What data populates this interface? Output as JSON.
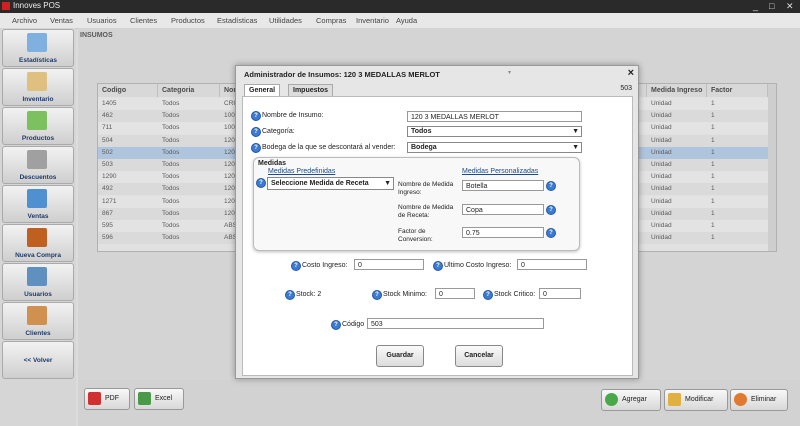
{
  "app": {
    "title": "Innoves POS",
    "minimize": "_",
    "maximize": "□",
    "close": "✕"
  },
  "menu": [
    "Archivo",
    "Ventas",
    "Usuarios",
    "Clientes",
    "Productos",
    "Estadísticas",
    "Utilidades",
    "Compras",
    "Inventario",
    "Ayuda"
  ],
  "sidebar": [
    {
      "label": "Estadísticas",
      "icon": "bar-chart-icon",
      "color": "#7fb0e0"
    },
    {
      "label": "Inventario",
      "icon": "pencil-icon",
      "color": "#e0c080"
    },
    {
      "label": "Productos",
      "icon": "basket-icon",
      "color": "#7cc060"
    },
    {
      "label": "Descuentos",
      "icon": "ticket-icon",
      "color": "#a0a0a0"
    },
    {
      "label": "Ventas",
      "icon": "cart-icon",
      "color": "#5090d0"
    },
    {
      "label": "Nueva Compra",
      "icon": "briefcase-icon",
      "color": "#c06020"
    },
    {
      "label": "Usuarios",
      "icon": "users-icon",
      "color": "#6090c0"
    },
    {
      "label": "Clientes",
      "icon": "clients-icon",
      "color": "#d09050"
    },
    {
      "label": "<< Volver",
      "icon": "",
      "color": ""
    }
  ],
  "main": {
    "section_label": "INSUMOS"
  },
  "grid": {
    "headers": [
      "Codigo",
      "Categoria",
      "Nom",
      "Medida Ingreso",
      "Factor Conversio"
    ],
    "rows": [
      [
        "1405",
        "Todos",
        "CRU",
        "Unidad",
        "1"
      ],
      [
        "462",
        "Todos",
        "100",
        "Unidad",
        "1"
      ],
      [
        "711",
        "Todos",
        "100",
        "Unidad",
        "1"
      ],
      [
        "504",
        "Todos",
        "120",
        "Unidad",
        "1"
      ],
      [
        "502",
        "Todos",
        "120",
        "Unidad",
        "1"
      ],
      [
        "503",
        "Todos",
        "120",
        "Unidad",
        "1"
      ],
      [
        "1290",
        "Todos",
        "120",
        "Unidad",
        "1"
      ],
      [
        "492",
        "Todos",
        "120",
        "Unidad",
        "1"
      ],
      [
        "1271",
        "Todos",
        "120",
        "Unidad",
        "1"
      ],
      [
        "867",
        "Todos",
        "120",
        "Unidad",
        "1"
      ],
      [
        "595",
        "Todos",
        "ABS",
        "Unidad",
        "1"
      ],
      [
        "596",
        "Todos",
        "ABS",
        "Unidad",
        "1"
      ]
    ],
    "selected_row": 4
  },
  "bottom": {
    "pdf": "PDF",
    "excel": "Excel",
    "agregar": "Agregar",
    "modificar": "Modificar",
    "eliminar": "Eliminar"
  },
  "dialog": {
    "title": "Administrador de Insumos: 120 3 MEDALLAS MERLOT",
    "close": "×",
    "tabs": [
      "General",
      "Impuestos"
    ],
    "code_display": "503",
    "nombre_label": "Nombre de Insumo:",
    "nombre_value": "120 3 MEDALLAS MERLOT",
    "categoria_label": "Categoría:",
    "categoria_value": "Todos",
    "bodega_label": "Bodega de la que se descontará al vender:",
    "bodega_value": "Bodega",
    "medidas": {
      "title": "Medidas",
      "predef_label": "Medidas Predefinidas",
      "personal_label": "Medidas Personalizadas",
      "select_value": "Seleccione Medida de Receta",
      "ingreso_label_1": "Nombre de Medida",
      "ingreso_label_2": "Ingreso:",
      "ingreso_value": "Botella",
      "receta_label_1": "Nombre de Medida",
      "receta_label_2": "de Receta:",
      "receta_value": "Copa",
      "factor_label_1": "Factor de",
      "factor_label_2": "Conversion:",
      "factor_value": "0.75"
    },
    "costo_ingreso_label": "Costo Ingreso:",
    "costo_ingreso_value": "0",
    "ultimo_costo_label": "Ultimo Costo Ingreso:",
    "ultimo_costo_value": "0",
    "stock_label": "Stock: 2",
    "stock_min_label": "Stock Minimo:",
    "stock_min_value": "0",
    "stock_crit_label": "Stock Critico:",
    "stock_crit_value": "0",
    "codigo_label": "Código",
    "codigo_value": "503",
    "guardar": "Guardar",
    "cancelar": "Cancelar"
  }
}
